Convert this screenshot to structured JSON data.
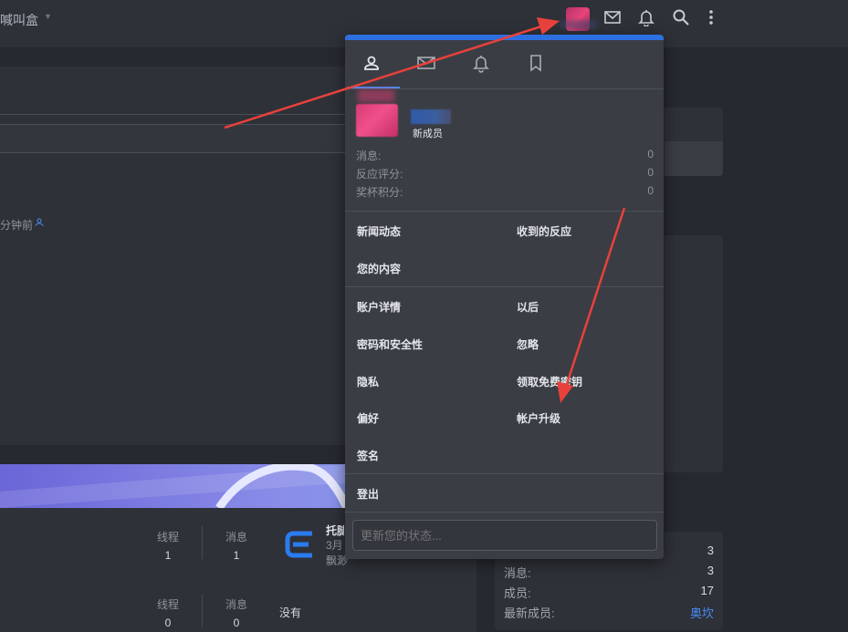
{
  "header": {
    "brand": "喊叫盒",
    "icons": [
      "avatar",
      "mail-icon",
      "bell-icon",
      "search-icon",
      "more-icon"
    ]
  },
  "left": {
    "time_text": "分钟前"
  },
  "lower": {
    "rows": [
      {
        "threads_label": "线程",
        "threads": "1",
        "messages_label": "消息",
        "messages": "1",
        "forum_title": "托腿",
        "forum_date": "3月",
        "forum_user": "飘渺"
      },
      {
        "threads_label": "线程",
        "threads": "0",
        "messages_label": "消息",
        "messages": "0",
        "latest": "没有"
      }
    ]
  },
  "right_stats": {
    "rows": [
      {
        "label": "",
        "value": "3"
      },
      {
        "label": "消息:",
        "value": "3"
      },
      {
        "label": "成员:",
        "value": "17"
      },
      {
        "label": "最新成员:",
        "value": "奥坎"
      }
    ]
  },
  "menu": {
    "tabs": [
      "user-icon",
      "mail-icon",
      "bell-icon",
      "bookmark-icon"
    ],
    "role": "新成员",
    "stats": [
      {
        "label": "消息:",
        "value": "0"
      },
      {
        "label": "反应评分:",
        "value": "0"
      },
      {
        "label": "奖杯积分:",
        "value": "0"
      }
    ],
    "links": {
      "news_feed": "新闻动态",
      "reactions_received": "收到的反应",
      "your_content": "您的内容",
      "account_details": "账户详情",
      "later": "以后",
      "password_security": "密码和安全性",
      "ignore": "忽略",
      "privacy": "隐私",
      "free_key": "领取免费密钥",
      "preferences": "偏好",
      "account_upgrade": "帐户升级",
      "signature": "签名",
      "logout": "登出"
    },
    "status_placeholder": "更新您的状态..."
  },
  "colors": {
    "accent": "#4c8bf5",
    "menu_top": "#2c6fe0",
    "annotation": "#e8413c"
  }
}
